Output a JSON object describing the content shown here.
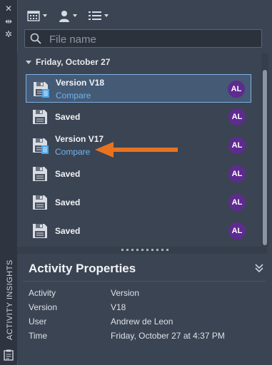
{
  "panel": {
    "side_title": "ACTIVITY INSIGHTS"
  },
  "search": {
    "placeholder": "File name"
  },
  "group": {
    "label": "Friday, October 27"
  },
  "activities": [
    {
      "title": "Version V18",
      "link": "Compare",
      "avatar": "AL",
      "selected": true
    },
    {
      "title": "Saved",
      "link": "",
      "avatar": "AL",
      "selected": false
    },
    {
      "title": "Version V17",
      "link": "Compare",
      "avatar": "AL",
      "selected": false
    },
    {
      "title": "Saved",
      "link": "",
      "avatar": "AL",
      "selected": false
    },
    {
      "title": "Saved",
      "link": "",
      "avatar": "AL",
      "selected": false
    },
    {
      "title": "Saved",
      "link": "",
      "avatar": "AL",
      "selected": false
    }
  ],
  "properties": {
    "title": "Activity Properties",
    "rows": [
      {
        "key": "Activity",
        "value": "Version"
      },
      {
        "key": "Version",
        "value": "V18"
      },
      {
        "key": "User",
        "value": "Andrew de Leon"
      },
      {
        "key": "Time",
        "value": "Friday, October 27 at 4:37 PM"
      }
    ]
  },
  "colors": {
    "accent_link": "#6fb4f0",
    "avatar_bg": "#5e2b8f",
    "annotation_arrow": "#e8731f",
    "selection_border": "#7fb0e3"
  },
  "icons": [
    "close-icon",
    "pin-icon",
    "settings-icon",
    "calendar-view-icon",
    "user-filter-icon",
    "list-view-icon",
    "search-icon",
    "file-save-icon",
    "collapse-icon",
    "activity-panel-icon"
  ]
}
